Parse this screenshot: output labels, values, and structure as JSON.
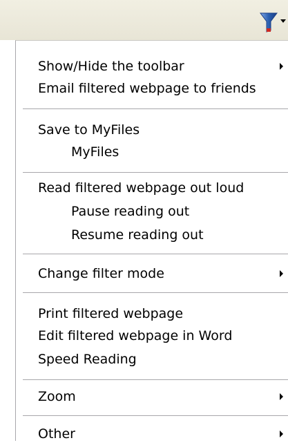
{
  "toolbar": {
    "filter_icon": "funnel-icon",
    "dropdown_icon": "dropdown-arrow-icon"
  },
  "menu": {
    "show_hide_toolbar": "Show/Hide the toolbar",
    "email_filtered": "Email filtered webpage to friends",
    "save_to_myfiles": "Save to MyFiles",
    "myfiles": "MyFiles",
    "read_out_loud": "Read filtered webpage out loud",
    "pause_reading": "Pause reading out",
    "resume_reading": "Resume reading out",
    "change_filter_mode": "Change filter mode",
    "print_filtered": "Print filtered webpage",
    "edit_in_word": "Edit filtered webpage in Word",
    "speed_reading": "Speed Reading",
    "zoom": "Zoom",
    "other": "Other"
  },
  "colors": {
    "toolbar_bg": "#ECE9D8",
    "funnel_blue": "#2a5fb0",
    "funnel_red": "#d02820",
    "separator": "#a7a6aa"
  }
}
